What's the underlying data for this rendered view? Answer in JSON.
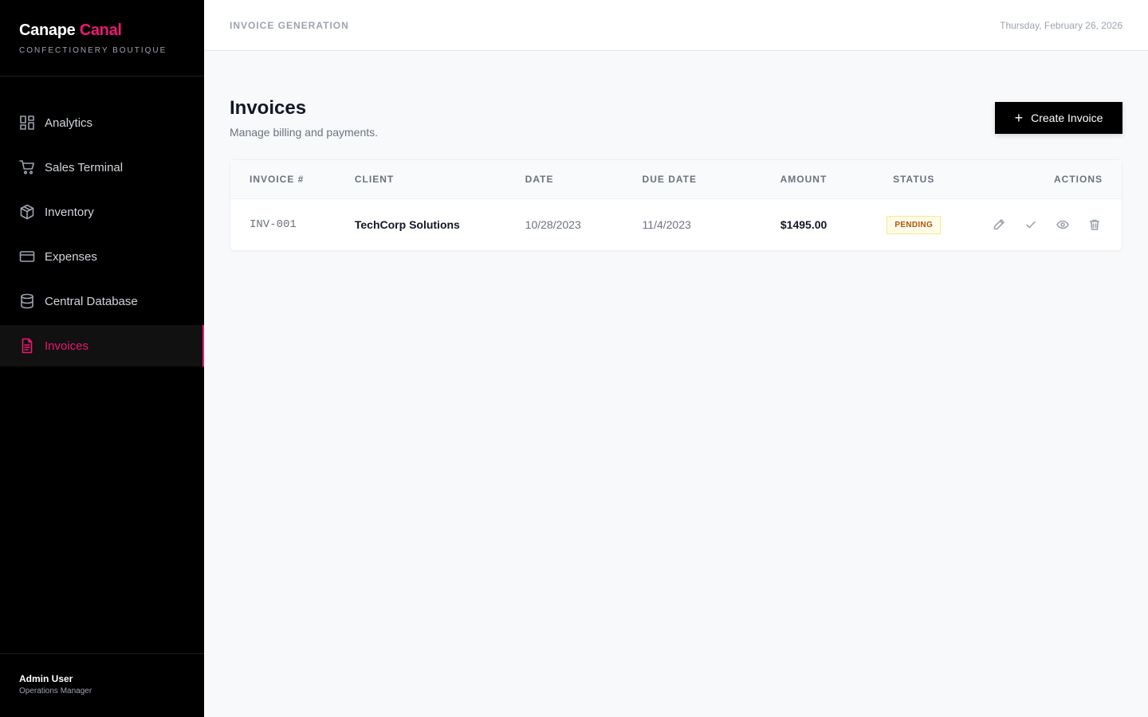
{
  "brand": {
    "name_main": "Canape",
    "name_accent": "Canal",
    "subtitle": "CONFECTIONERY BOUTIQUE"
  },
  "nav": [
    {
      "label": "Analytics",
      "icon": "grid-icon"
    },
    {
      "label": "Sales Terminal",
      "icon": "cart-icon"
    },
    {
      "label": "Inventory",
      "icon": "box-icon"
    },
    {
      "label": "Expenses",
      "icon": "card-icon"
    },
    {
      "label": "Central Database",
      "icon": "database-icon"
    },
    {
      "label": "Invoices",
      "icon": "file-text-icon",
      "active": true
    }
  ],
  "user": {
    "name": "Admin User",
    "role": "Operations Manager"
  },
  "header": {
    "title": "INVOICE GENERATION",
    "date": "Thursday, February 26, 2026"
  },
  "page": {
    "title": "Invoices",
    "subtitle": "Manage billing and payments.",
    "create_label": "Create Invoice"
  },
  "table": {
    "columns": [
      "INVOICE #",
      "CLIENT",
      "DATE",
      "DUE DATE",
      "AMOUNT",
      "STATUS",
      "ACTIONS"
    ],
    "rows": [
      {
        "invoice": "INV-001",
        "client": "TechCorp Solutions",
        "date": "10/28/2023",
        "due": "11/4/2023",
        "amount": "$1495.00",
        "status": "PENDING"
      }
    ]
  },
  "colors": {
    "accent": "#ec1873",
    "sidebar_bg": "#000000",
    "status_pending_bg": "#fefce8",
    "status_pending_text": "#b45309"
  }
}
